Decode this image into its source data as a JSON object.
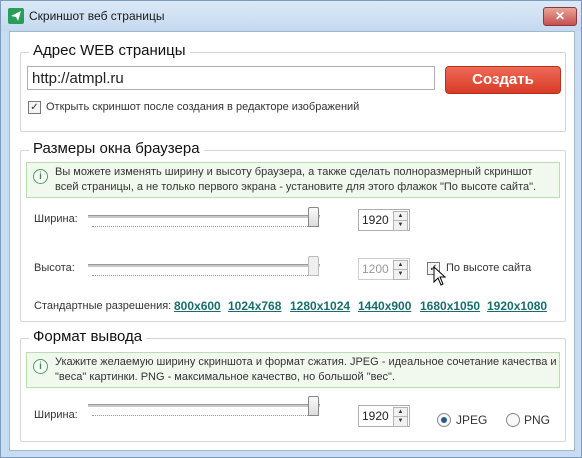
{
  "window": {
    "title": "Скриншот веб страницы",
    "close_label": "✕"
  },
  "url_section": {
    "title": "Адрес WEB страницы",
    "url_value": "http://atmpl.ru",
    "create_label": "Создать",
    "open_in_editor_label": "Открыть скриншот после создания в редакторе изображений",
    "open_in_editor_checked": true
  },
  "browser_section": {
    "title": "Размеры окна браузера",
    "info_line1": "Вы можете изменять ширину и высоту браузера, а также сделать полноразмерный скриншот",
    "info_line2": "всей страницы, а не только первого экрана - установите для этого флажок \"По высоте сайта\".",
    "width_label": "Ширина:",
    "width_value": "1920",
    "height_label": "Высота:",
    "height_value": "1200",
    "fit_height_label": "По высоте сайта",
    "fit_height_checked": true,
    "standard_label": "Стандартные разрешения:",
    "resolutions": [
      "800x600",
      "1024x768",
      "1280x1024",
      "1440x900",
      "1680x1050",
      "1920x1080"
    ]
  },
  "format_section": {
    "title": "Формат вывода",
    "info_line1": "Укажите желаемую ширину скриншота и формат сжатия. JPEG - идеальное сочетание качества и",
    "info_line2": "\"веса\" картинки. PNG - максимальное качество, но большой \"вес\".",
    "width_label": "Ширина:",
    "width_value": "1920",
    "format_options": [
      "JPEG",
      "PNG"
    ],
    "selected_format": "JPEG"
  }
}
